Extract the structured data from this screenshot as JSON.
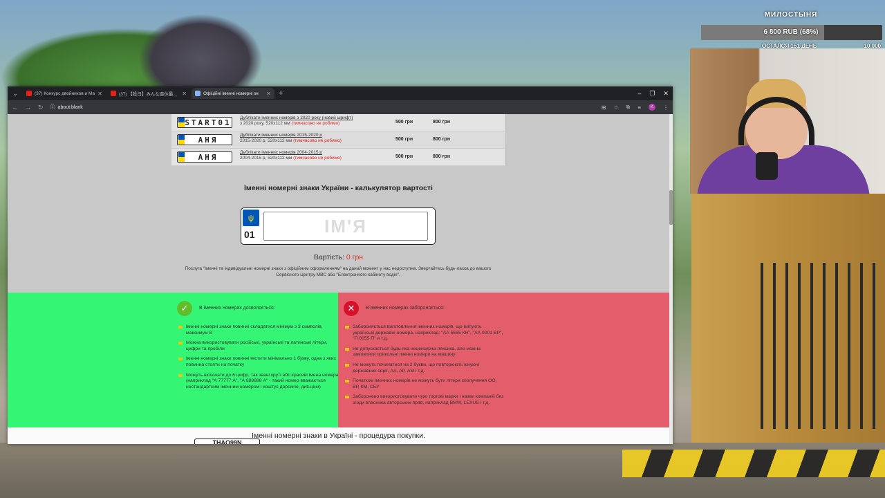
{
  "overlay": {
    "donation_title": "МИЛОСТЫНЯ",
    "donation_amount": "6 800 RUB (68%)",
    "donation_progress": 0.68,
    "donation_left": "ОСТАЛСЯ 151 ДЕНЬ",
    "donation_goal": "10 000"
  },
  "browser": {
    "tabs": [
      {
        "title": "(37) Конкурс двойников и Ма",
        "icon": "youtube-icon"
      },
      {
        "title": "(37) 【投日】みんな遊休最後の日",
        "icon": "youtube-icon"
      },
      {
        "title": "Офіційні іменні номерні зн",
        "icon": "document-icon"
      }
    ],
    "new_tab": "+",
    "url": "about:blank",
    "avatar_letter": "K"
  },
  "price_table": {
    "rows": [
      {
        "plate": "START01",
        "flag": "ua-flag",
        "title": "Дублікати іменних номерів з 2020 року (новий шрифт)",
        "sub": "з 2020 року, 520х112 мм",
        "note": "(тимчасово не робимо)",
        "price1": "500 грн",
        "price2": "800 грн"
      },
      {
        "plate": "АНЯ",
        "flag": "ua-flag",
        "title": "Дублікати іменних номерів 2015-2020 р",
        "sub": "2015-2020 р, 520х112 мм",
        "note": "(тимчасово не робимо)",
        "price1": "500 грн",
        "price2": "800 грн"
      },
      {
        "plate": "АНЯ",
        "flag": "ua-flag",
        "title": "Дублікати іменних номерів 2004-2015 р",
        "sub": "2004-2015 р, 520х112 мм",
        "note": "(тимчасово не робимо)",
        "price1": "500 грн",
        "price2": "800 грн"
      }
    ]
  },
  "calculator": {
    "title": "Іменні номерні знаки України - калькулятор вартості",
    "region": "01",
    "input_placeholder": "ІМ'Я",
    "input_value": "",
    "cost_label": "Вартість:",
    "cost_value": "0 грн",
    "notice": "Послуга \"Іменні та індивідуальні номерні знаки з офіційним оформленням\" на даний момент у нас недоступна. Звертайтесь будь-ласка до вашого Сервісного Центру МВС або \"Електронного кабінету водія\"."
  },
  "allowed": {
    "icon": "check-icon",
    "heading": "В іменних номерах дозволяється:",
    "items": [
      "Іменні номерні знаки повинні складатися мінімум з 3 символів, максимум 8",
      "Можна використовувати російські, українські та латинські літери, цифри та пробіли",
      "Іменні номерні знаки повинні містити мінімально 1 букву, одна з яких повинна стояти на початку",
      "Можуть включати до 6 цифр, так звані круті або красиві імена номера (наприклад \"А 77777 А\", \"А 888888 А\" - такий номер вважається нестандартним іменним номером і коштує дорожче, див.ціни)"
    ]
  },
  "forbidden": {
    "icon": "cross-icon",
    "heading": "В іменних номерах забороняється:",
    "items": [
      "Забороняється виготовлення іменних номерів, що імітують українські державні номера, наприклад: \"АА 5555 КН\", \"АА 0001 ВР\", \"П 0055 П\" и т.д.",
      "Не допускається будь-яка нецензурна лексика, але можна замовляти прикольні іменні номери на машину",
      "Не можуть починатися на 2 букви, що повторюють існуючі державних серії, АА, АР, АМ і т.д.",
      "Початком іменних номерів не можуть бути літери сполучення ОО, ВР, КМ, СБУ",
      "Заборонено використовувати чужі торгові марки і назви компаній без згоди власника авторських прав, наприклад BMW, LEXUS і т.д."
    ]
  },
  "footer": {
    "title": "Іменні номерні знаки в Україні - процедура покупки.",
    "plate": "THAQ99N"
  }
}
